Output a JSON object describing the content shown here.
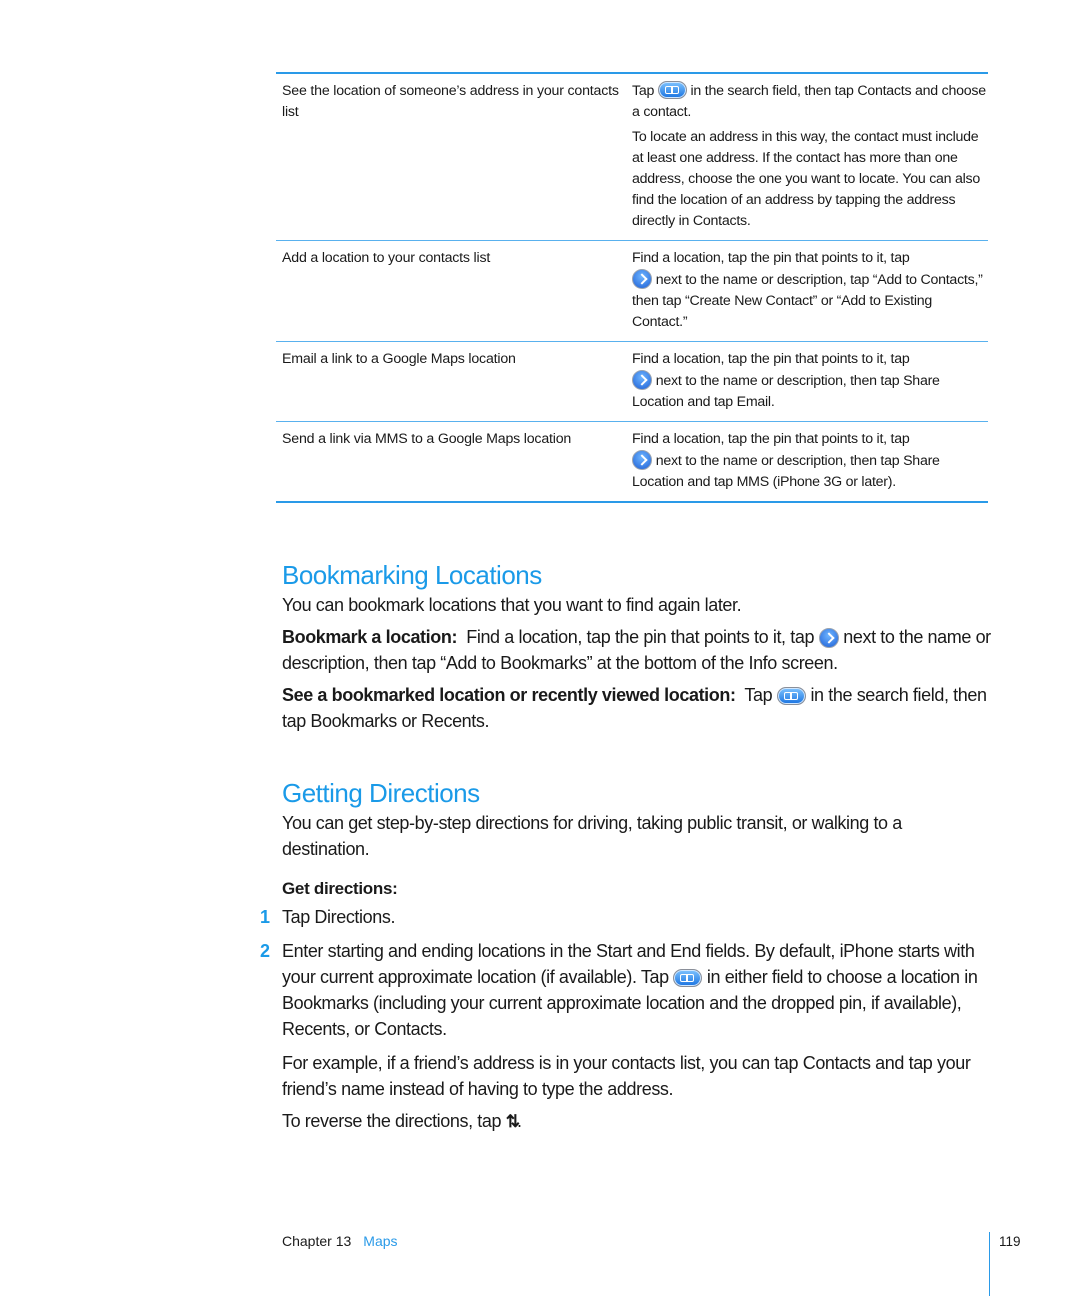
{
  "table": {
    "rows": [
      {
        "task": "See the location of someone’s address in your contacts list",
        "action_parts": [
          {
            "before": "Tap ",
            "icon": "bookmarks-icon",
            "after": " in the search field, then tap Contacts and choose a contact."
          },
          {
            "text": "To locate an address in this way, the contact must include at least one address. If the contact has more than one address, choose the one you want to locate. You can also find the location of an address by tapping the address directly in Contacts."
          }
        ]
      },
      {
        "task": "Add a location to your contacts list",
        "action_before": "Find a location, tap the pin that points to it, tap",
        "icon": "disclosure-arrow-icon",
        "action_after": " next to the name or description, tap “Add to Contacts,” then tap “Create New Contact” or “Add to Existing Contact.”"
      },
      {
        "task": "Email a link to a Google Maps location",
        "action_before": "Find a location, tap the pin that points to it, tap",
        "icon": "disclosure-arrow-icon",
        "action_after": " next to the name or description, then tap Share Location and tap Email."
      },
      {
        "task": "Send a link via MMS to a Google Maps location",
        "action_before": "Find a location, tap the pin that points to it, tap",
        "icon": "disclosure-arrow-icon",
        "action_after": " next to the name or description, then tap Share Location and tap MMS (iPhone 3G or later)."
      }
    ]
  },
  "bookmarking": {
    "heading": "Bookmarking Locations",
    "intro": "You can bookmark locations that you want to find again later.",
    "bookmark_label": "Bookmark a location:",
    "bookmark_before": "  Find a location, tap the pin that points to it, tap ",
    "bookmark_after": " next to the name or description, then tap “Add to Bookmarks” at the bottom of the Info screen.",
    "see_label": "See a bookmarked location or recently viewed location:",
    "see_before": "  Tap ",
    "see_after": " in the search field, then tap Bookmarks or Recents."
  },
  "directions": {
    "heading": "Getting Directions",
    "intro": "You can get step-by-step directions for driving, taking public transit, or walking to a destination.",
    "task_label": "Get directions:",
    "steps": [
      {
        "num": "1",
        "text": "Tap Directions."
      },
      {
        "num": "2",
        "before": "Enter starting and ending locations in the Start and End fields. By default, iPhone starts with your current approximate location (if available). Tap ",
        "after": " in either field to choose a location in Bookmarks (including your current approximate location and the dropped pin, if available), Recents, or Contacts."
      }
    ],
    "example": "For example, if a friend’s address is in your contacts list, you can tap Contacts and tap your friend’s name instead of having to type the address.",
    "reverse_before": "To reverse the directions, tap ",
    "reverse_icon_glyph": "⇅",
    "reverse_after": "."
  },
  "footer": {
    "chapter": "Chapter 13",
    "chapter_name": "Maps",
    "page_number": "119"
  },
  "colors": {
    "accent": "#1a9ae8",
    "rule": "#2a9ae8",
    "text": "#1a1a1a"
  }
}
